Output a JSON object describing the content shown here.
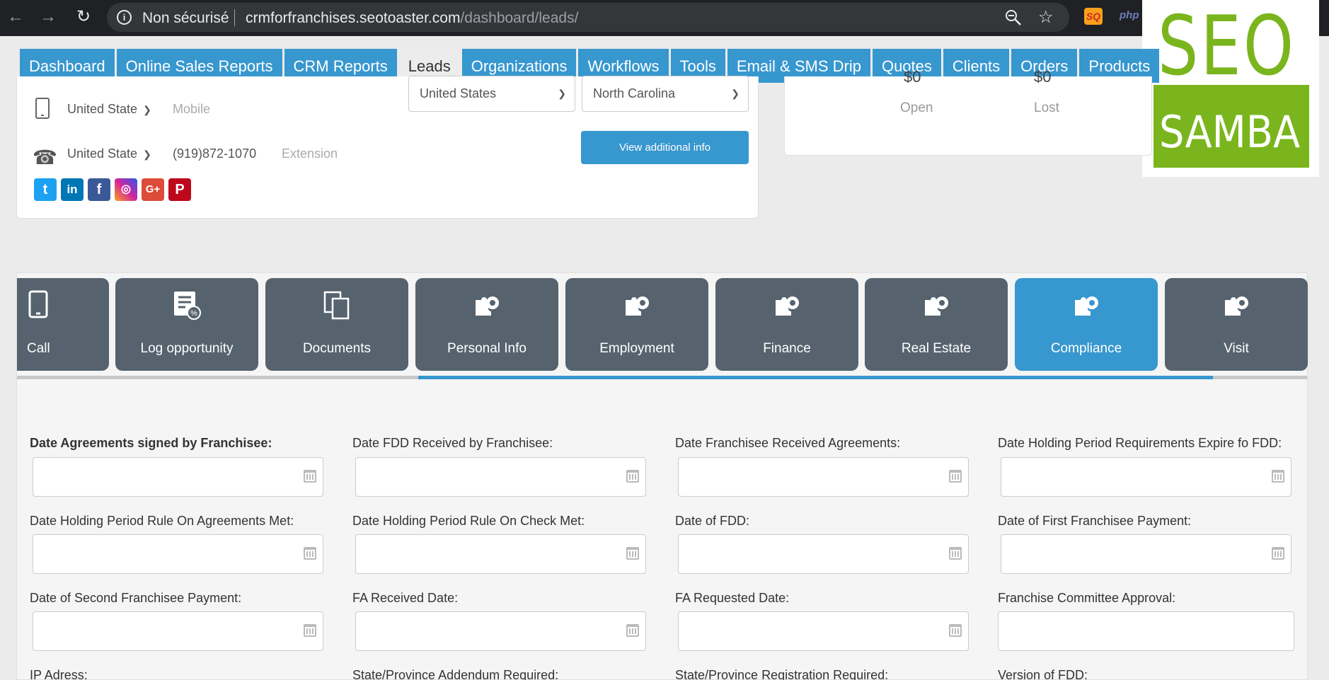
{
  "browser": {
    "back_icon": "arrow-left-icon",
    "forward_icon": "arrow-right-icon",
    "reload_icon": "reload-icon",
    "security_label": "Non sécurisé",
    "url_host": "crmforfranchises.seotoaster.com",
    "url_path": "/dashboard/leads/",
    "ext_sq": "SQ",
    "ext_php": "php"
  },
  "logo": {
    "top": "SEO",
    "bottom": "SAMBA",
    "color": "#7ab51d"
  },
  "nav": {
    "items": [
      "Dashboard",
      "Online Sales Reports",
      "CRM Reports",
      "Leads",
      "Organizations",
      "Workflows",
      "Tools",
      "Email & SMS Drip",
      "Quotes",
      "Clients",
      "Orders",
      "Products"
    ],
    "active": "Leads",
    "accent": "#3797cf"
  },
  "contact": {
    "mobile_country": "United State",
    "mobile_placeholder": "Mobile",
    "phone_country": "United State",
    "phone_number": "(919)872-1070",
    "extension_placeholder": "Extension",
    "country_select": "United States",
    "state_select": "North Carolina",
    "view_button": "View additional info",
    "social_icons": [
      "twitter-icon",
      "linkedin-icon",
      "facebook-icon",
      "instagram-icon",
      "google-plus-icon",
      "pinterest-icon"
    ]
  },
  "stats": {
    "open_label": "Open",
    "lost_label": "Lost",
    "open_value": "$0",
    "lost_value": "$0"
  },
  "tiles": {
    "items": [
      {
        "label": "Call",
        "icon": "mobile-phone-icon"
      },
      {
        "label": "Log opportunity",
        "icon": "log-opportunity-icon"
      },
      {
        "label": "Documents",
        "icon": "documents-icon"
      },
      {
        "label": "Personal Info",
        "icon": "puzzle-gear-icon"
      },
      {
        "label": "Employment",
        "icon": "puzzle-gear-icon"
      },
      {
        "label": "Finance",
        "icon": "puzzle-gear-icon"
      },
      {
        "label": "Real Estate",
        "icon": "puzzle-gear-icon"
      },
      {
        "label": "Compliance",
        "icon": "puzzle-gear-icon"
      },
      {
        "label": "Visit",
        "icon": "puzzle-gear-icon"
      }
    ],
    "active": "Compliance"
  },
  "form": {
    "row1": [
      "Date Agreements signed by Franchisee:",
      "Date FDD Received by Franchisee:",
      "Date Franchisee Received Agreements:",
      "Date Holding Period Requirements Expire fo FDD:"
    ],
    "row2": [
      "Date Holding Period Rule On Agreements Met:",
      "Date Holding Period Rule On Check Met:",
      "Date of FDD:",
      "Date of First Franchisee Payment:"
    ],
    "row3": [
      "Date of Second Franchisee Payment:",
      "FA Received Date:",
      "FA Requested Date:",
      "Franchise Committee Approval:"
    ],
    "row4": [
      "IP Adress:",
      "State/Province Addendum Required:",
      "State/Province Registration Required:",
      "Version of FDD:"
    ]
  }
}
